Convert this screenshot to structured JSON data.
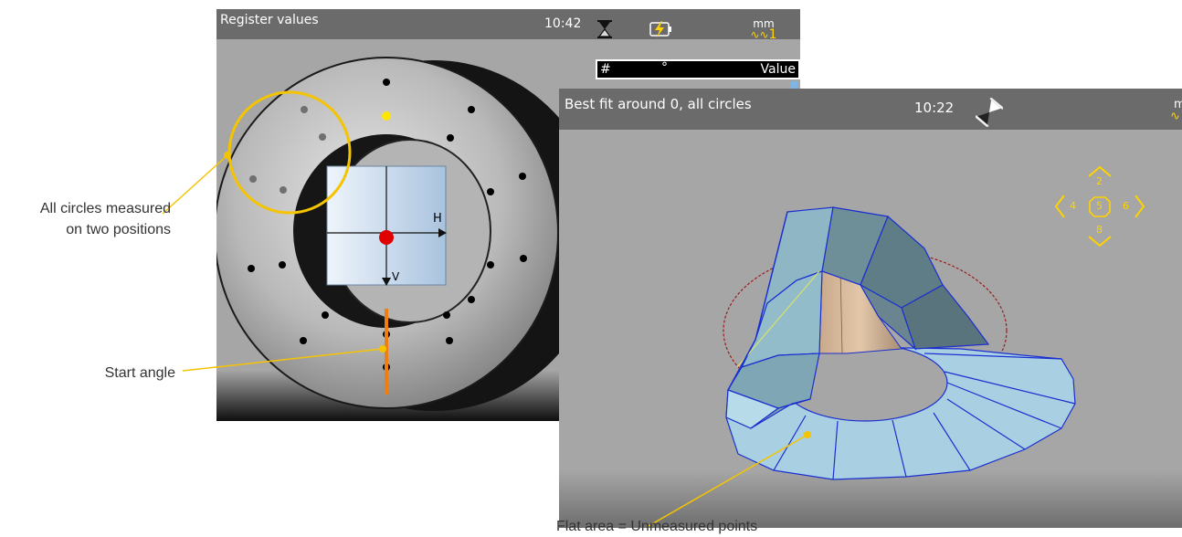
{
  "left_screen": {
    "title": "Register values",
    "time": "10:42",
    "unit": "mm",
    "unit_index": "1",
    "table": {
      "col_number": "#",
      "col_angle": "°",
      "col_value": "Value"
    },
    "axis_h": "H",
    "axis_v": "V"
  },
  "right_screen": {
    "title": "Best fit around 0, all circles",
    "time": "10:22",
    "unit_partial": "m",
    "nav": {
      "up": "2",
      "left": "4",
      "center": "5",
      "right": "6",
      "down": "8"
    }
  },
  "callouts": {
    "all_circles_line1": "All circles measured",
    "all_circles_line2": "on two positions",
    "start_angle": "Start angle",
    "flat_area": "Flat area = Unmeasured points"
  },
  "colors": {
    "titlebar": "#6b6b6b",
    "callout_line": "#f5c400",
    "accent_yellow": "#ffd200",
    "center_dot": "#e00000",
    "start_angle": "#f07d10",
    "surface": "#a8cede",
    "surface_edge": "#1a2fd0"
  },
  "icons": {
    "hourglass": "hourglass-icon",
    "battery": "battery-charging-icon",
    "waveform": "waveform-icon",
    "nav_pad": "navigation-pad-icon"
  }
}
